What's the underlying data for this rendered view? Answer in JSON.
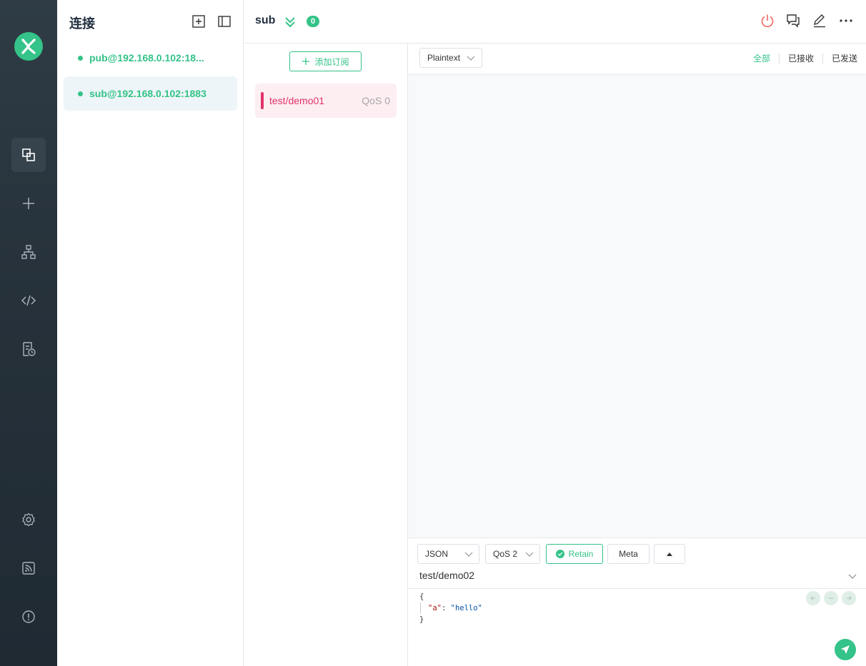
{
  "sidebar": {
    "title": "连接",
    "connections": [
      {
        "name": "pub@192.168.0.102:18...",
        "status": "connected"
      },
      {
        "name": "sub@192.168.0.102:1883",
        "status": "connected"
      }
    ]
  },
  "rail": {
    "icons": [
      "connections-icon",
      "plus-icon",
      "topology-icon",
      "code-icon",
      "log-icon",
      "settings-icon",
      "feed-icon",
      "info-icon"
    ]
  },
  "header": {
    "title": "sub",
    "message_count": "0"
  },
  "subscriptions": {
    "add_button": "添加订阅",
    "items": [
      {
        "topic": "test/demo01",
        "qos": "QoS 0",
        "color": "#e1336a"
      }
    ]
  },
  "messages": {
    "format": "Plaintext",
    "filters": [
      "全部",
      "已接收",
      "已发送"
    ],
    "active_filter": "全部"
  },
  "publish": {
    "payload_format": "JSON",
    "qos": "QoS 2",
    "retain_label": "Retain",
    "meta_label": "Meta",
    "topic": "test/demo02",
    "payload_lines": [
      "{",
      "\"a\": \"hello\"",
      "}"
    ],
    "payload_key": "\"a\"",
    "payload_value": "\"hello\""
  },
  "colors": {
    "accent": "#34c388",
    "subscription": "#e1336a",
    "rail": "#2b3740"
  }
}
